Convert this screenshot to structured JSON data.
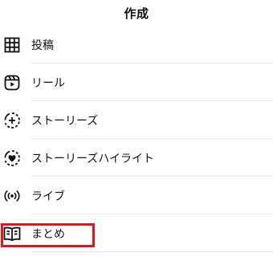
{
  "header": {
    "title": "作成"
  },
  "menu": {
    "items": [
      {
        "label": "投稿",
        "icon": "grid-icon"
      },
      {
        "label": "リール",
        "icon": "reels-icon"
      },
      {
        "label": "ストーリーズ",
        "icon": "story-add-icon"
      },
      {
        "label": "ストーリーズハイライト",
        "icon": "story-highlight-heart-icon"
      },
      {
        "label": "ライブ",
        "icon": "live-icon"
      },
      {
        "label": "まとめ",
        "icon": "guide-book-icon"
      }
    ]
  },
  "highlight": {
    "color": "#e0161e",
    "target": "まとめ"
  }
}
